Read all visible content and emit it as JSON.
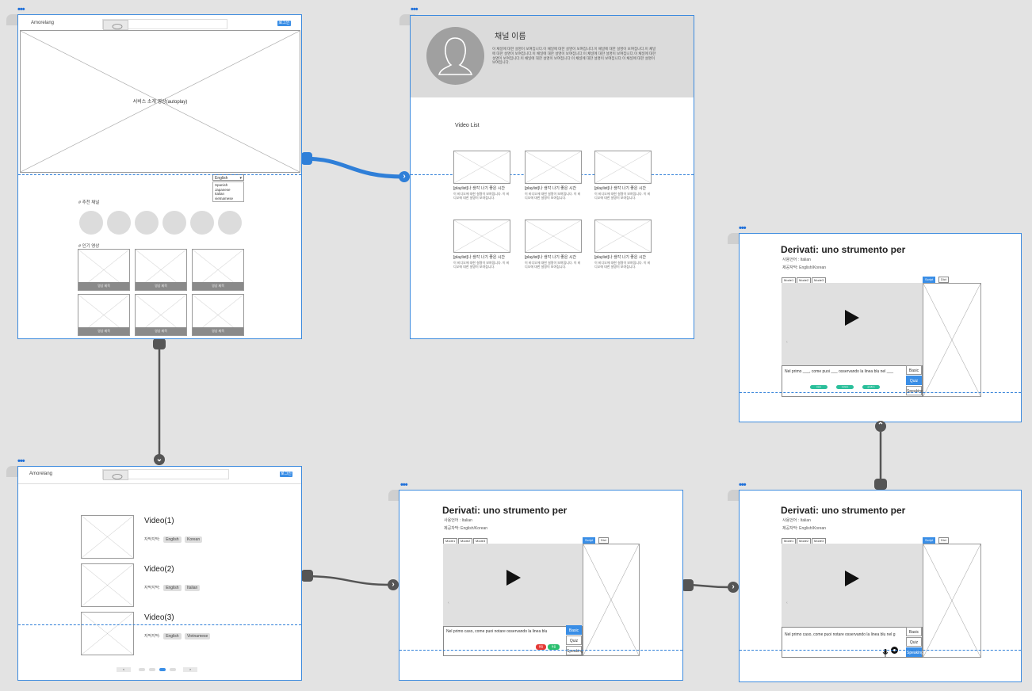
{
  "frames": {
    "home": {
      "logo": "Amorelang",
      "login": "로그인",
      "hero": "서비스 소개 영상(autoplay)",
      "language_select": "English",
      "language_options": [
        "Spanish",
        "Japanese",
        "Italian",
        "vietnamese"
      ],
      "recommended_title": "# 추천 채널",
      "popular_title": "# 인기 영상",
      "thumb_label": "영상 제목"
    },
    "channel": {
      "name": "채널 이름",
      "description": "이 채널에 대한 설명이 보여집니다.이 채널에 대한 설명이 보여집니다.이 채널에 대한 설명이 보여집니다.이 채널에 대한 설명이 보여집니다.이 채널에 대한 설명이 보여집니다.이 채널에 대한 설명이 보여집니다.이 채널에 대한 설명이 보여집니다.이 채널에 대한 설명이 보여집니다.이 채널에 대한 설명이 보여집니다.이 채널에 대한 설명이 보여집니다.",
      "list_title": "Video List",
      "videos": [
        {
          "title": "[playlist]나 생각 나기 좋은 시간",
          "desc": "이 비디오에 대한 설명이 보여집니다. 이 비디오에 대한 설명이 보여집니다."
        },
        {
          "title": "[playlist]나 생각 나기 좋은 시간",
          "desc": "이 비디오에 대한 설명이 보여집니다. 이 비디오에 대한 설명이 보여집니다."
        },
        {
          "title": "[playlist]나 생각 나기 좋은 시간",
          "desc": "이 비디오에 대한 설명이 보여집니다. 이 비디오에 대한 설명이 보여집니다."
        },
        {
          "title": "[playlist]나 생각 나기 좋은 시간",
          "desc": "이 비디오에 대한 설명이 보여집니다. 이 비디오에 대한 설명이 보여집니다."
        },
        {
          "title": "[playlist]나 생각 나기 좋은 시간",
          "desc": "이 비디오에 대한 설명이 보여집니다. 이 비디오에 대한 설명이 보여집니다."
        },
        {
          "title": "[playlist]나 생각 나기 좋은 시간",
          "desc": "이 비디오에 대한 설명이 보여집니다. 이 비디오에 대한 설명이 보여집니다."
        }
      ]
    },
    "search": {
      "logo": "Amorelang",
      "login": "로그인",
      "subtitle_label": "자막지막:",
      "results": [
        {
          "title": "Video(1)",
          "tags": [
            "English",
            "Korean"
          ]
        },
        {
          "title": "Video(2)",
          "tags": [
            "English",
            "Italian"
          ]
        },
        {
          "title": "Video(3)",
          "tags": [
            "English",
            "Vietnamese"
          ]
        }
      ],
      "prev": "<",
      "next": ">"
    },
    "player": {
      "title": "Derivati: uno strumento per",
      "meta1": "사용언어 : Italian",
      "meta2": "제공자막: English/Korean",
      "mode_tabs": [
        "Mode1",
        "Mode2",
        "Mode3"
      ],
      "side_tabs": [
        "Script",
        "Dict"
      ],
      "sentence_a": "Nel primo caso, come puoi notare osservando la linea blu",
      "sentence_b": "Nel primo ___, come puoi ___ osservando la linea blu nel ___",
      "sentence_c": "Nel primo caso, come puoi notare osservando la linea blu nel g",
      "buttons": [
        "Basic",
        "Quiz",
        "Speaking"
      ],
      "pill_red": "틀림",
      "pill_green": "맞음",
      "quiz_pills": [
        "caso",
        "notare",
        "grafico"
      ]
    }
  }
}
